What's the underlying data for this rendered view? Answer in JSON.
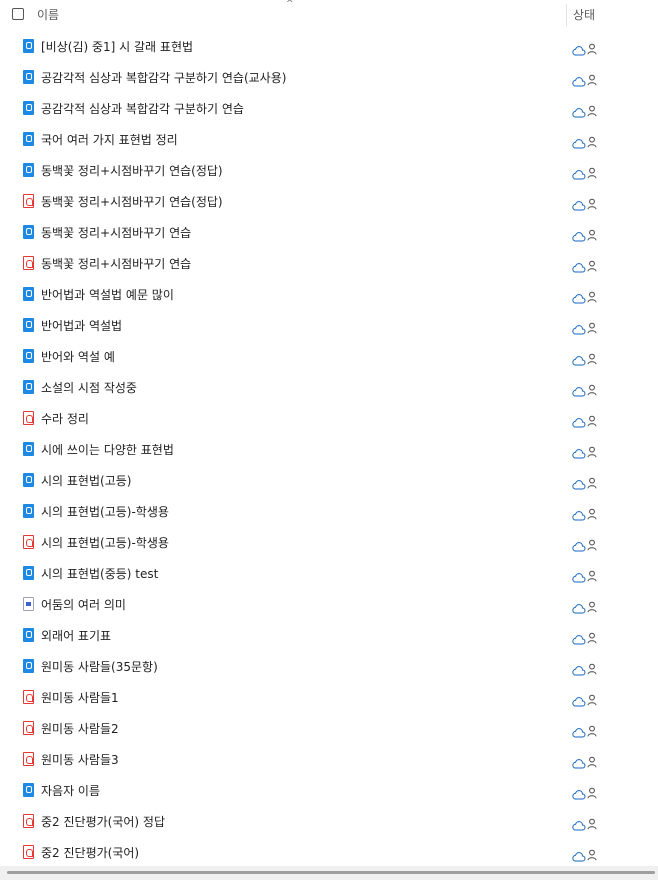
{
  "header": {
    "name_label": "이름",
    "status_label": "상태",
    "sort_indicator": "^"
  },
  "files": [
    {
      "name": "[비상(김) 중1] 시 갈래 표현법",
      "type": "word"
    },
    {
      "name": "공감각적 심상과 복합감각 구분하기 연습(교사용)",
      "type": "word"
    },
    {
      "name": "공감각적 심상과 복합감각 구분하기 연습",
      "type": "word"
    },
    {
      "name": "국어 여러 가지 표현법 정리",
      "type": "word"
    },
    {
      "name": "동백꽃 정리+시점바꾸기 연습(정답)",
      "type": "word"
    },
    {
      "name": "동백꽃 정리+시점바꾸기 연습(정답)",
      "type": "pdf"
    },
    {
      "name": "동백꽃 정리+시점바꾸기 연습",
      "type": "word"
    },
    {
      "name": "동백꽃 정리+시점바꾸기 연습",
      "type": "pdf"
    },
    {
      "name": "반어법과 역설법 예문 많이",
      "type": "word"
    },
    {
      "name": "반어법과 역설법",
      "type": "word"
    },
    {
      "name": "반어와 역설 예",
      "type": "word"
    },
    {
      "name": "소설의 시점 작성중",
      "type": "word"
    },
    {
      "name": "수라 정리",
      "type": "pdf"
    },
    {
      "name": "시에 쓰이는 다양한 표현법",
      "type": "word"
    },
    {
      "name": "시의 표현법(고등)",
      "type": "word"
    },
    {
      "name": "시의 표현법(고등)-학생용",
      "type": "word"
    },
    {
      "name": "시의 표현법(고등)-학생용",
      "type": "pdf"
    },
    {
      "name": "시의 표현법(중등) test",
      "type": "word"
    },
    {
      "name": "어둠의 여러 의미",
      "type": "doc"
    },
    {
      "name": "외래어 표기표",
      "type": "word"
    },
    {
      "name": "원미동 사람들(35문항)",
      "type": "word"
    },
    {
      "name": "원미동 사람들1",
      "type": "pdf"
    },
    {
      "name": "원미동 사람들2",
      "type": "pdf"
    },
    {
      "name": "원미동 사람들3",
      "type": "pdf"
    },
    {
      "name": "자음자 이름",
      "type": "word"
    },
    {
      "name": "중2 진단평가(국어) 정답",
      "type": "pdf"
    },
    {
      "name": "중2 진단평가(국어)",
      "type": "pdf"
    }
  ],
  "status_icons": [
    "cloud-icon",
    "shared-person-icon"
  ],
  "colors": {
    "word_blue": "#1e88e5",
    "pdf_red": "#e53935",
    "status_blue": "#1565c0"
  }
}
